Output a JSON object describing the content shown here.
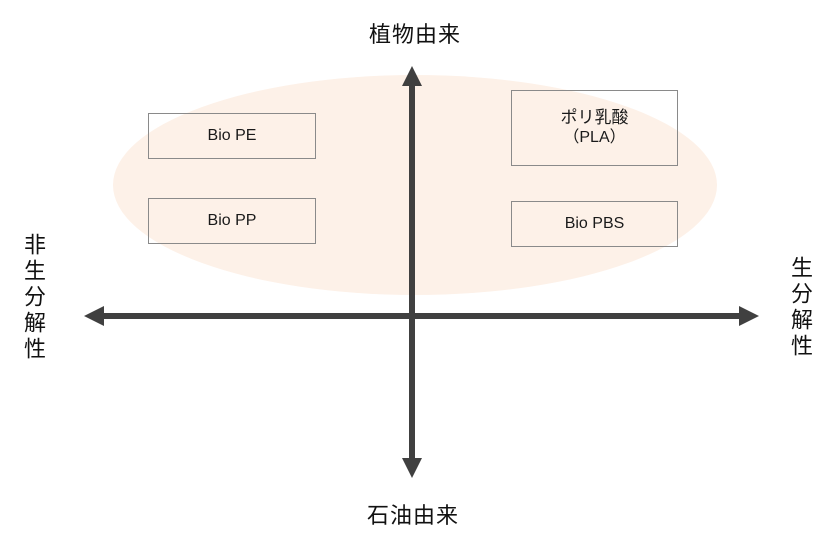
{
  "diagram": {
    "title": "",
    "axes": {
      "top": "植物由来",
      "bottom": "石油由来",
      "left": "非生分解性",
      "right": "生分解性"
    },
    "highlight_region": {
      "label": "",
      "color": "#fdf1e8",
      "meaning": "plant-derived"
    },
    "colors": {
      "axis": "#404040",
      "box_border": "#8a8a8a",
      "text": "#111111"
    },
    "items": [
      {
        "id": "bio-pe",
        "quadrant": "top-left",
        "lines": [
          "Bio PE"
        ]
      },
      {
        "id": "bio-pp",
        "quadrant": "top-left",
        "lines": [
          "Bio PP"
        ]
      },
      {
        "id": "pla",
        "quadrant": "top-right",
        "lines": [
          "ポリ乳酸",
          "（PLA）"
        ]
      },
      {
        "id": "bio-pbs",
        "quadrant": "top-right",
        "lines": [
          "Bio PBS"
        ]
      }
    ]
  }
}
